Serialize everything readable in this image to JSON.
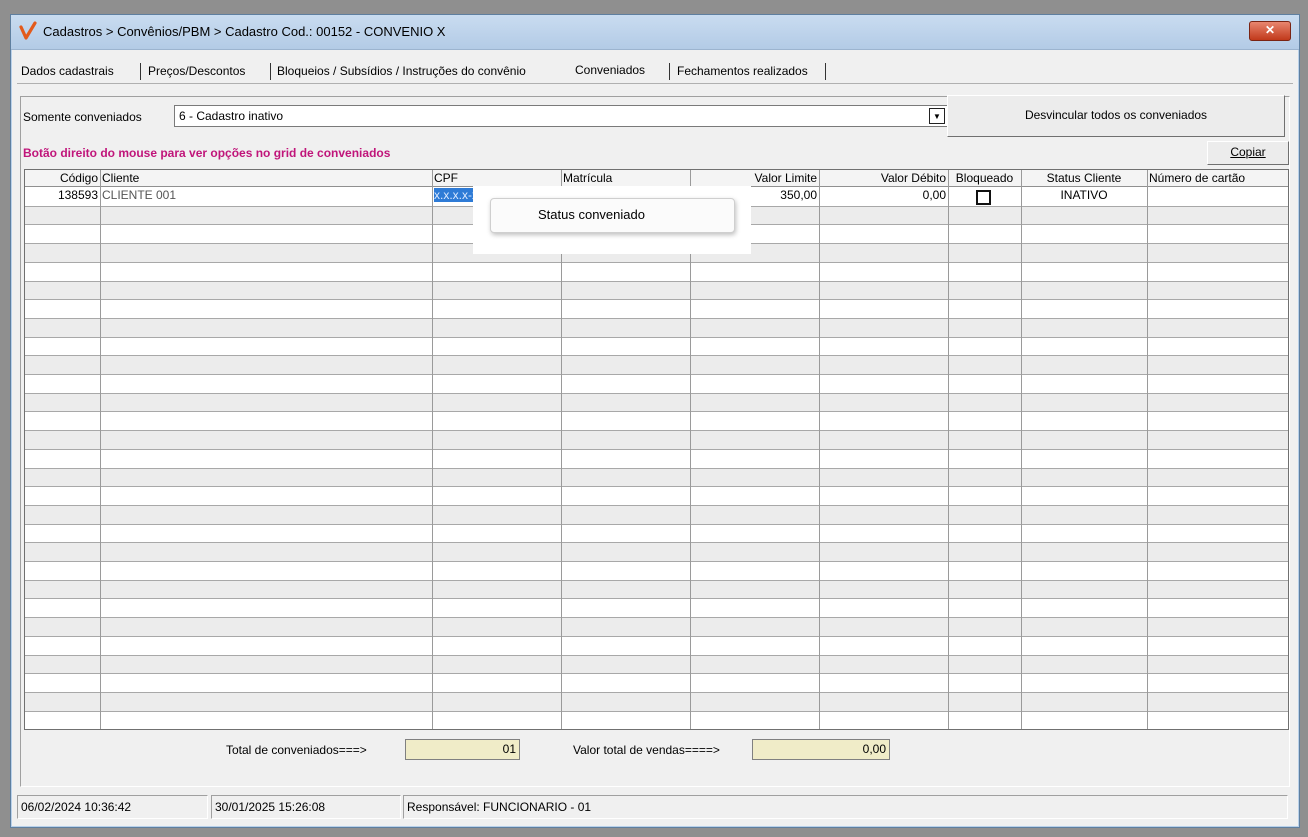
{
  "window": {
    "title": "Cadastros > Convênios/PBM > Cadastro  Cod.: 00152 - CONVENIO X",
    "close_label": "✕"
  },
  "tabs": [
    {
      "label": "Dados cadastrais"
    },
    {
      "label": "Preços/Descontos"
    },
    {
      "label": "Bloqueios / Subsídios / Instruções do convênio"
    },
    {
      "label": "Conveniados"
    },
    {
      "label": "Fechamentos realizados"
    }
  ],
  "active_tab": "Conveniados",
  "filter": {
    "label": "Somente conveniados",
    "value": "6 - Cadastro inativo"
  },
  "buttons": {
    "unlink_all": "Desvincular todos os conveniados",
    "copy": "Copiar"
  },
  "hint": "Botão direito do mouse para ver opções no grid de conveniados",
  "grid": {
    "columns": [
      "Código",
      "Cliente",
      "CPF",
      "Matrícula",
      "Valor Limite",
      "Valor Débito",
      "Bloqueado",
      "Status Cliente",
      "Número de cartão"
    ],
    "rows": [
      {
        "codigo": "138593",
        "cliente": "CLIENTE 001",
        "cpf": "x.x.x.x-xx",
        "matricula": "",
        "valor_limite": "350,00",
        "valor_debito": "0,00",
        "bloqueado": false,
        "status_cliente": "INATIVO",
        "numero_cartao": ""
      }
    ]
  },
  "context_menu": {
    "items": [
      "Status conveniado"
    ]
  },
  "totals": {
    "conveniados_label": "Total de conveniados===>",
    "conveniados_value": "01",
    "vendas_label": "Valor total de vendas====>",
    "vendas_value": "0,00"
  },
  "statusbar": {
    "date1": "06/02/2024 10:36:42",
    "date2": "30/01/2025 15:26:08",
    "responsavel": "Responsável: FUNCIONARIO - 01"
  },
  "colors": {
    "hint": "#c0157a",
    "selection": "#2e7bd6",
    "logo": "#e35a1b"
  }
}
